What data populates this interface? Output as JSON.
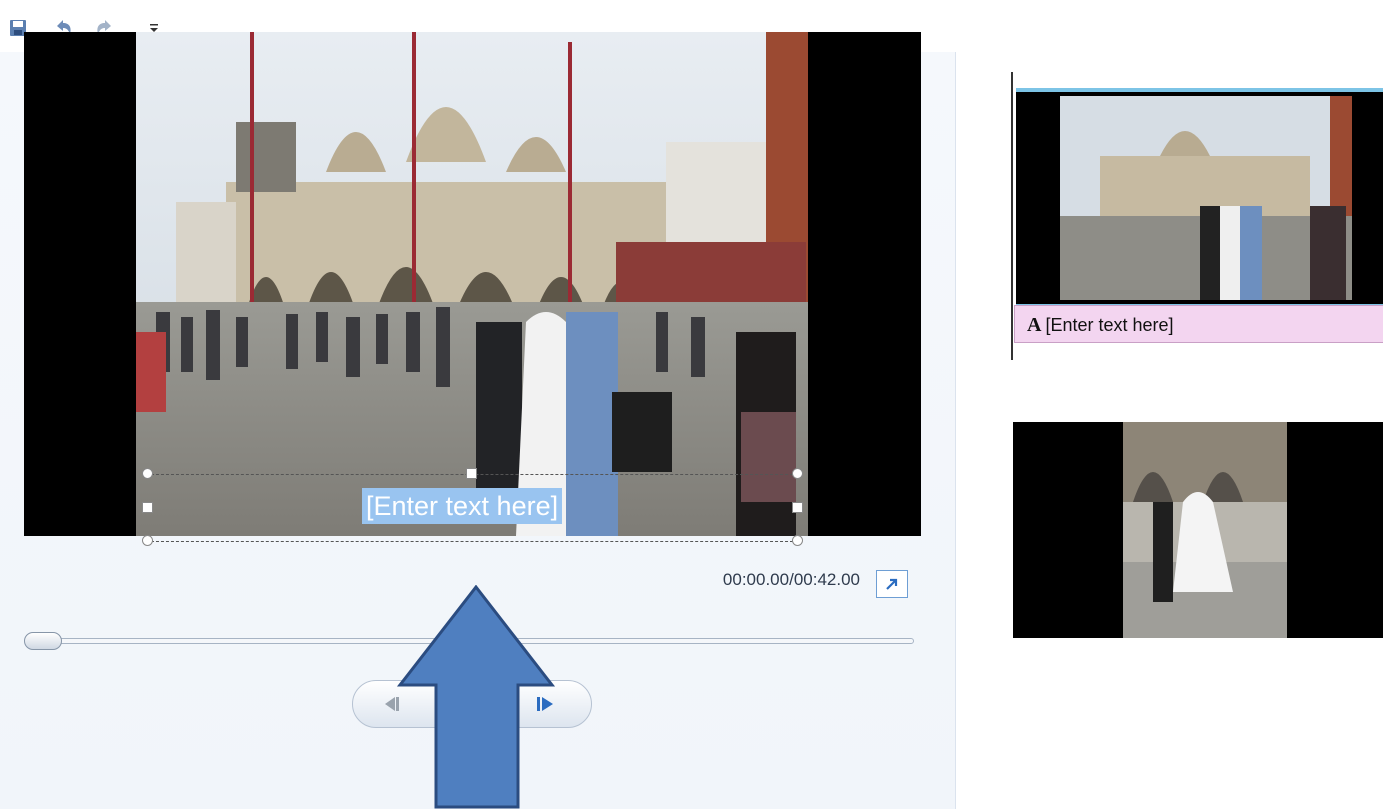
{
  "toolbar": {
    "items": [
      {
        "name": "save",
        "icon": "save-icon"
      },
      {
        "name": "undo",
        "icon": "undo-icon"
      },
      {
        "name": "redo",
        "icon": "redo-icon"
      },
      {
        "name": "customize",
        "icon": "dropdown-arrow-icon"
      }
    ]
  },
  "preview": {
    "caption_text": "[Enter text here]",
    "time_readout": "00:00.00/00:42.00",
    "seek_position_fraction": 0,
    "fullscreen_icon": "expand-icon",
    "transport": {
      "previous_frame_icon": "previous-frame-icon",
      "play_icon": "play-icon",
      "next_frame_icon": "next-frame-icon"
    }
  },
  "storyboard": {
    "clips": [
      {
        "caption": "[Enter text here]",
        "caption_icon": "text-caption-icon",
        "selected": true
      },
      {
        "caption": "",
        "selected": false
      }
    ]
  },
  "annotation": {
    "icon": "up-arrow-icon",
    "color": "#4f7fc0"
  },
  "colors": {
    "selection_blue": "#7dc4e6",
    "caption_highlight": "#99c4f0",
    "caption_bar": "#f3d5f0"
  }
}
